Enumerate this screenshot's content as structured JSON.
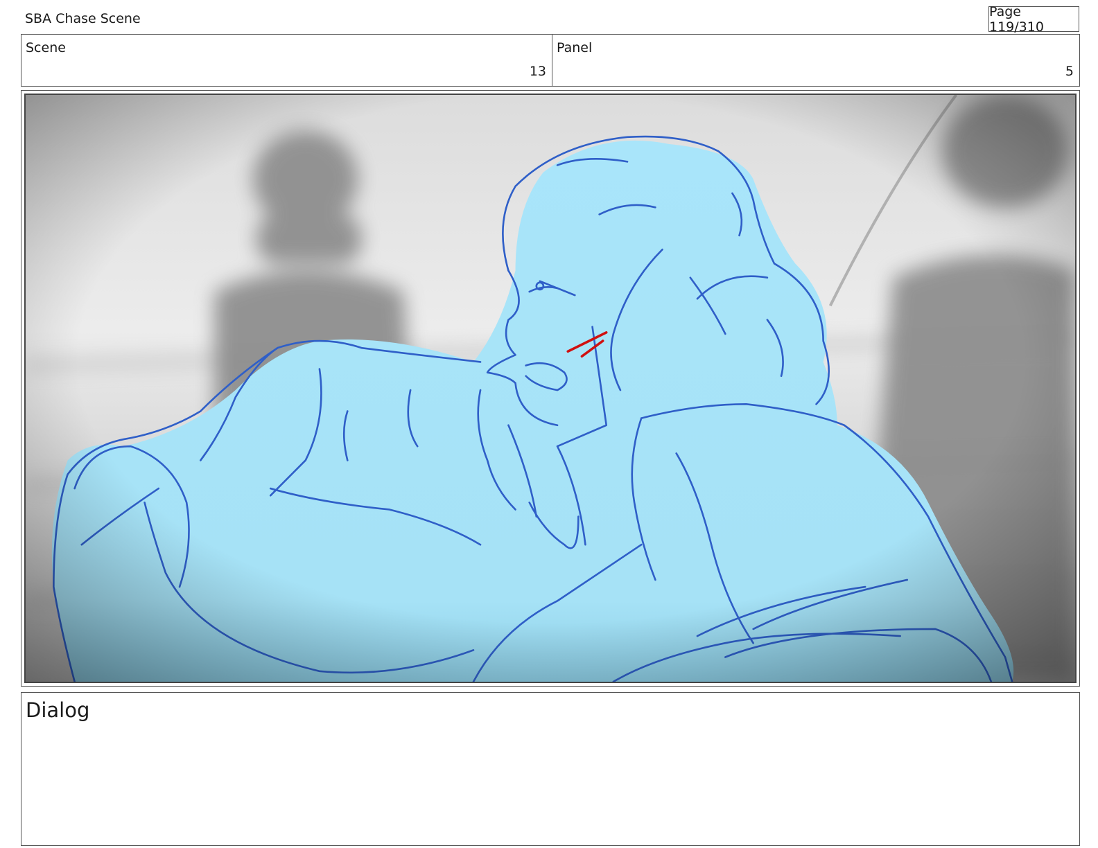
{
  "header": {
    "title": "SBA Chase Scene",
    "page_indicator": "Page 119/310"
  },
  "info": {
    "scene_label": "Scene",
    "scene_value": "13",
    "panel_label": "Panel",
    "panel_value": "5"
  },
  "dialog": {
    "label": "Dialog",
    "text": ""
  },
  "colors": {
    "figure_fill": "#a8e4f8",
    "figure_line": "#2f5fc8",
    "accent_mark": "#d01010",
    "background_gray": "#c8c8c8"
  }
}
